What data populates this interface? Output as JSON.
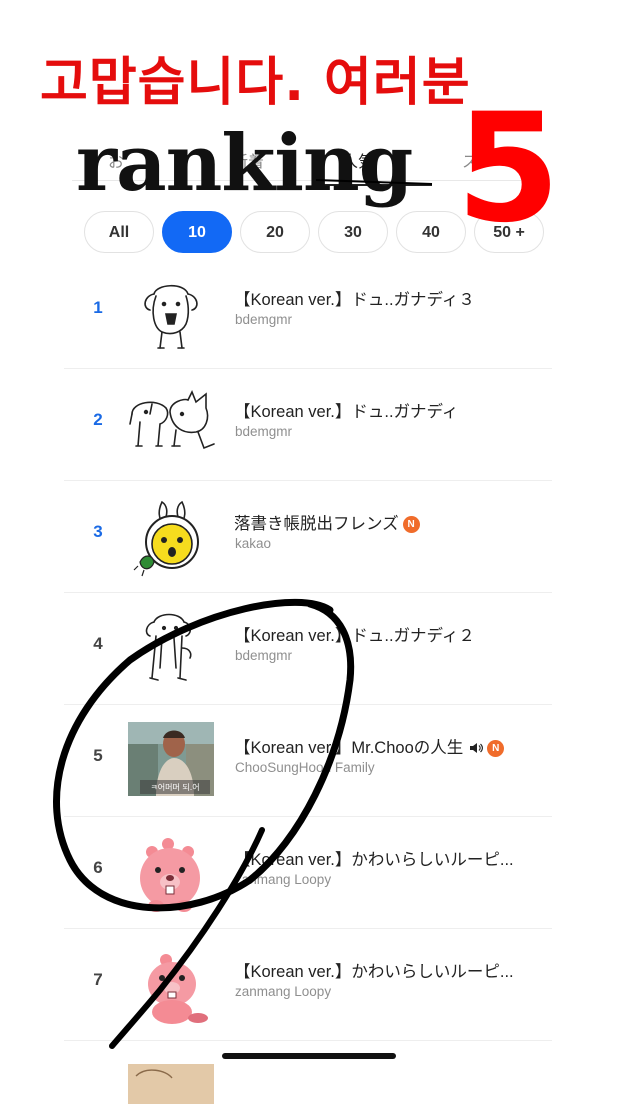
{
  "overlay": {
    "headline": "고맙습니다. 여러분",
    "ranking_word": "ranking",
    "ranking_number": "5"
  },
  "tabs": [
    {
      "label": "お"
    },
    {
      "label": "新着"
    },
    {
      "label": "人気"
    },
    {
      "label": "ス"
    }
  ],
  "filters": [
    {
      "label": "All",
      "active": false
    },
    {
      "label": "10",
      "active": true
    },
    {
      "label": "20",
      "active": false
    },
    {
      "label": "30",
      "active": false
    },
    {
      "label": "40",
      "active": false
    },
    {
      "label": "50 +",
      "active": false
    }
  ],
  "list": [
    {
      "rank": "1",
      "title": "【Korean ver.】ドュ..ガナディ３",
      "author": "bdemgmr",
      "icon": "dog-sketch-icon"
    },
    {
      "rank": "2",
      "title": "【Korean ver.】ドュ..ガナディ",
      "author": "bdemgmr",
      "icon": "dog-and-cat-sketch-icon"
    },
    {
      "rank": "3",
      "title": "落書き帳脱出フレンズ",
      "author": "kakao",
      "icon": "bunny-character-icon",
      "new_badge": "N"
    },
    {
      "rank": "4",
      "title": "【Korean ver.】ドュ..ガナディ２",
      "author": "bdemgmr",
      "icon": "long-dog-sketch-icon"
    },
    {
      "rank": "5",
      "title": "【Korean ver.】Mr.Chooの人生",
      "author": "ChooSungHoon Family",
      "icon": "photo-thumbnail",
      "new_badge": "N",
      "caption": "ㅋ어머머 되.어"
    },
    {
      "rank": "6",
      "title": "【Korean ver.】かわいらしいルーピ...",
      "author": "zanmang Loopy",
      "icon": "pink-beaver-icon"
    },
    {
      "rank": "7",
      "title": "【Korean ver.】かわいらしいルーピ...",
      "author": "zanmang Loopy",
      "icon": "pink-beaver-icon"
    }
  ],
  "colors": {
    "accent": "#1269f5",
    "rank_top": "#1a6ae5",
    "overlay_red": "#e50d0d",
    "new_badge": "#f06c2b"
  }
}
